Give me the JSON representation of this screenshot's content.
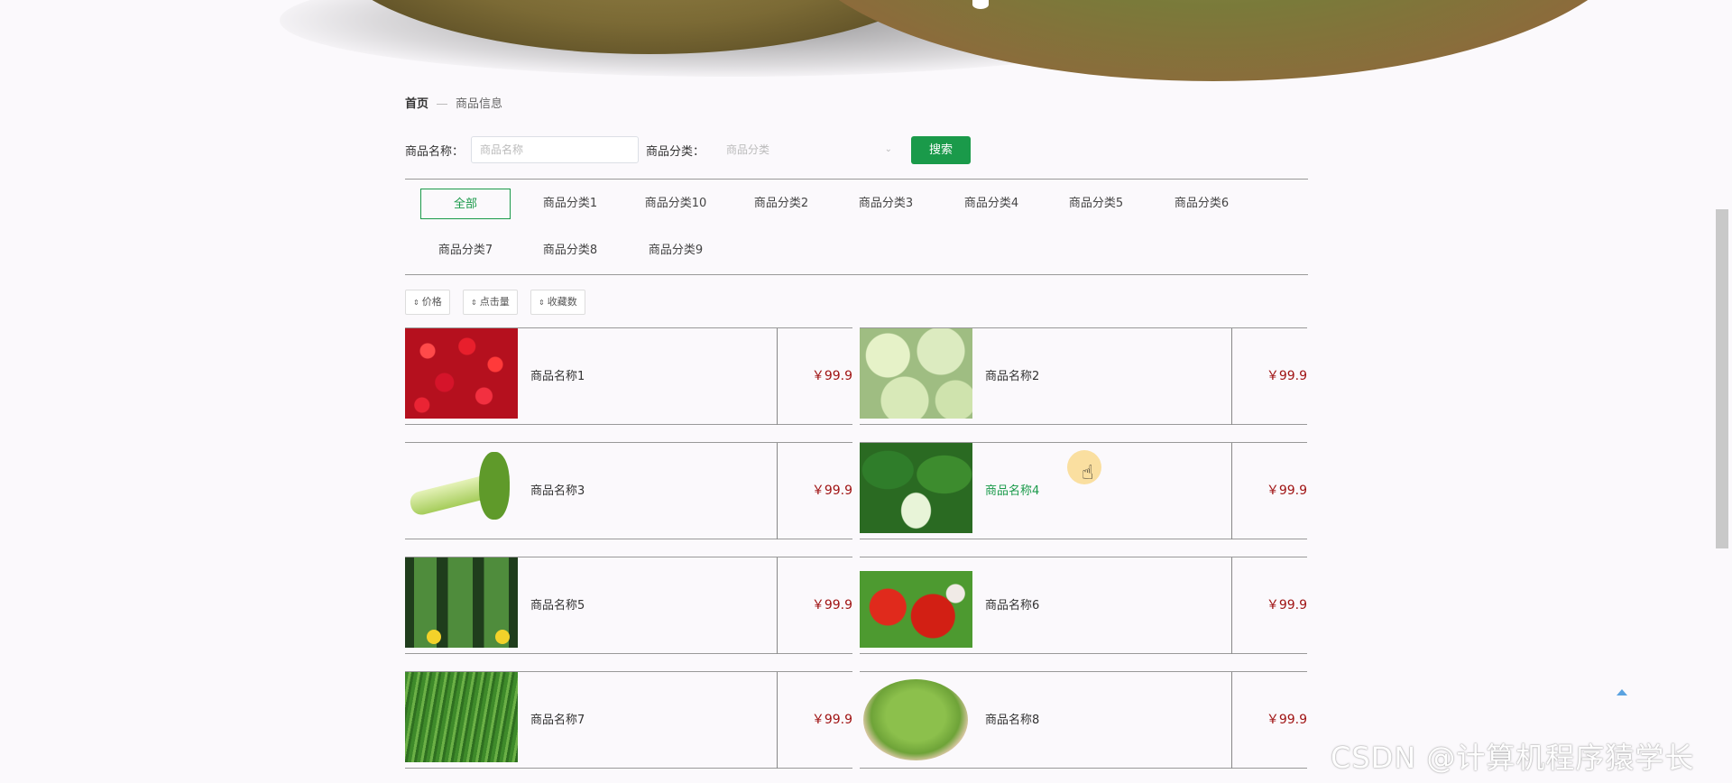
{
  "breadcrumb": {
    "home": "首页",
    "current": "商品信息"
  },
  "search": {
    "name_label": "商品名称：",
    "name_placeholder": "商品名称",
    "category_label": "商品分类：",
    "category_placeholder": "商品分类",
    "button": "搜索"
  },
  "categories": [
    "全部",
    "商品分类1",
    "商品分类10",
    "商品分类2",
    "商品分类3",
    "商品分类4",
    "商品分类5",
    "商品分类6",
    "商品分类7",
    "商品分类8",
    "商品分类9"
  ],
  "active_category": "全部",
  "sort": [
    "价格",
    "点击量",
    "收藏数"
  ],
  "products": [
    {
      "name": "商品名称1",
      "price": "￥99.9",
      "icon": "radish-image"
    },
    {
      "name": "商品名称2",
      "price": "￥99.9",
      "icon": "cabbage-image"
    },
    {
      "name": "商品名称3",
      "price": "￥99.9",
      "icon": "celery-image"
    },
    {
      "name": "商品名称4",
      "price": "￥99.9",
      "icon": "bok-choy-image"
    },
    {
      "name": "商品名称5",
      "price": "￥99.9",
      "icon": "luffa-image"
    },
    {
      "name": "商品名称6",
      "price": "￥99.9",
      "icon": "tomato-image"
    },
    {
      "name": "商品名称7",
      "price": "￥99.9",
      "icon": "green-beans-image"
    },
    {
      "name": "商品名称8",
      "price": "￥99.9",
      "icon": "edamame-image"
    }
  ],
  "hovered_product": "商品名称4",
  "watermark": "CSDN @计算机程序猿学长",
  "colors": {
    "accent": "#1a9a4a",
    "price": "#a01414",
    "background": "#fbf9fc"
  }
}
